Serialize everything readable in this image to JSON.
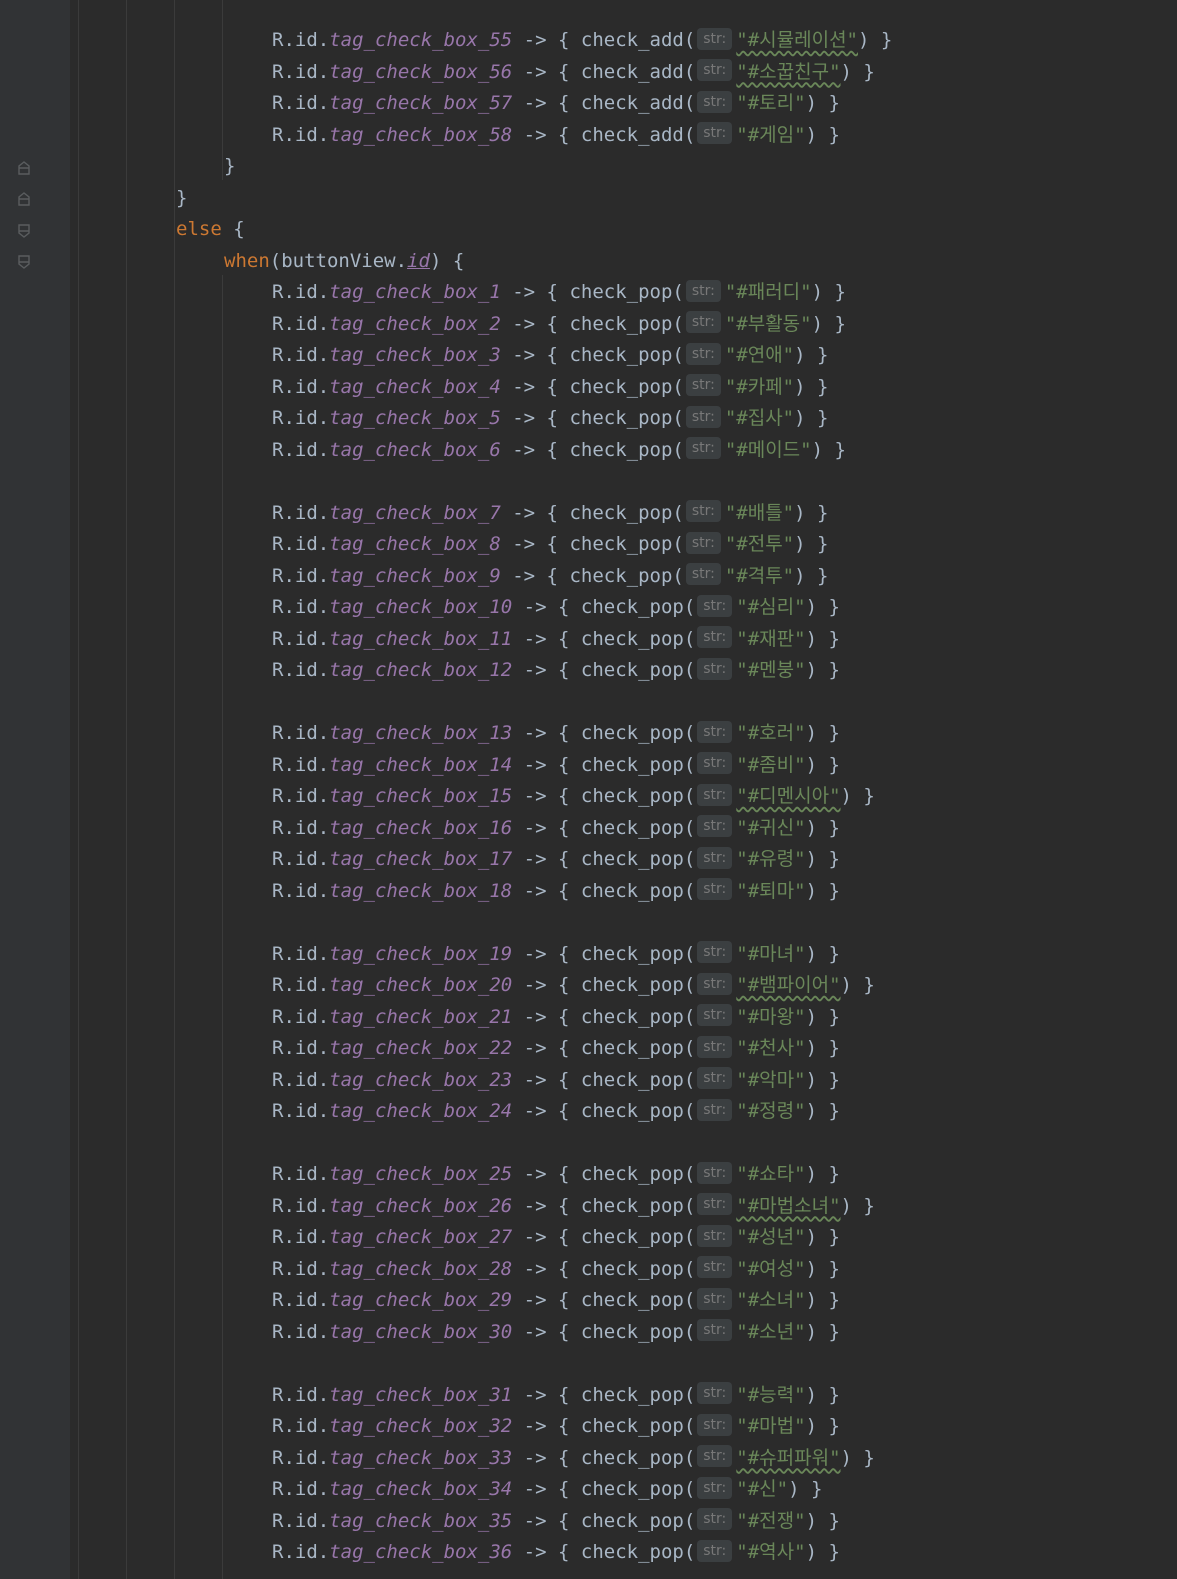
{
  "editor": {
    "lines_top": [
      {
        "prefix": "R.id.",
        "tag": "tag_check_box_55",
        "call": "check_add",
        "hint": "str:",
        "arg": "\"#시뮬레이션\""
      },
      {
        "prefix": "R.id.",
        "tag": "tag_check_box_56",
        "call": "check_add",
        "hint": "str:",
        "arg": "\"#소꿉친구\""
      },
      {
        "prefix": "R.id.",
        "tag": "tag_check_box_57",
        "call": "check_add",
        "hint": "str:",
        "arg": "\"#토리\""
      },
      {
        "prefix": "R.id.",
        "tag": "tag_check_box_58",
        "call": "check_add",
        "hint": "str:",
        "arg": "\"#게임\""
      }
    ],
    "close_brace": "}",
    "else_kw": "else",
    "open_brace": " {",
    "when_kw": "when",
    "when_expr_pre": "(buttonView.",
    "when_expr_id": "id",
    "when_expr_post": ") {",
    "arrow": " -> { ",
    "paren_open": "(",
    "paren_close": ") }",
    "lines_pop": [
      {
        "tag": "tag_check_box_1",
        "arg": "\"#패러디\""
      },
      {
        "tag": "tag_check_box_2",
        "arg": "\"#부활동\""
      },
      {
        "tag": "tag_check_box_3",
        "arg": "\"#연애\""
      },
      {
        "tag": "tag_check_box_4",
        "arg": "\"#카페\""
      },
      {
        "tag": "tag_check_box_5",
        "arg": "\"#집사\""
      },
      {
        "tag": "tag_check_box_6",
        "arg": "\"#메이드\""
      },
      {
        "tag": "tag_check_box_7",
        "arg": "\"#배틀\""
      },
      {
        "tag": "tag_check_box_8",
        "arg": "\"#전투\""
      },
      {
        "tag": "tag_check_box_9",
        "arg": "\"#격투\""
      },
      {
        "tag": "tag_check_box_10",
        "arg": "\"#심리\""
      },
      {
        "tag": "tag_check_box_11",
        "arg": "\"#재판\""
      },
      {
        "tag": "tag_check_box_12",
        "arg": "\"#멘붕\""
      },
      {
        "tag": "tag_check_box_13",
        "arg": "\"#호러\""
      },
      {
        "tag": "tag_check_box_14",
        "arg": "\"#좀비\""
      },
      {
        "tag": "tag_check_box_15",
        "arg": "\"#디멘시아\""
      },
      {
        "tag": "tag_check_box_16",
        "arg": "\"#귀신\""
      },
      {
        "tag": "tag_check_box_17",
        "arg": "\"#유령\""
      },
      {
        "tag": "tag_check_box_18",
        "arg": "\"#퇴마\""
      },
      {
        "tag": "tag_check_box_19",
        "arg": "\"#마녀\""
      },
      {
        "tag": "tag_check_box_20",
        "arg": "\"#뱀파이어\""
      },
      {
        "tag": "tag_check_box_21",
        "arg": "\"#마왕\""
      },
      {
        "tag": "tag_check_box_22",
        "arg": "\"#천사\""
      },
      {
        "tag": "tag_check_box_23",
        "arg": "\"#악마\""
      },
      {
        "tag": "tag_check_box_24",
        "arg": "\"#정령\""
      },
      {
        "tag": "tag_check_box_25",
        "arg": "\"#쇼타\""
      },
      {
        "tag": "tag_check_box_26",
        "arg": "\"#마법소녀\""
      },
      {
        "tag": "tag_check_box_27",
        "arg": "\"#성년\""
      },
      {
        "tag": "tag_check_box_28",
        "arg": "\"#여성\""
      },
      {
        "tag": "tag_check_box_29",
        "arg": "\"#소녀\""
      },
      {
        "tag": "tag_check_box_30",
        "arg": "\"#소년\""
      },
      {
        "tag": "tag_check_box_31",
        "arg": "\"#능력\""
      },
      {
        "tag": "tag_check_box_32",
        "arg": "\"#마법\""
      },
      {
        "tag": "tag_check_box_33",
        "arg": "\"#슈퍼파워\""
      },
      {
        "tag": "tag_check_box_34",
        "arg": "\"#신\""
      },
      {
        "tag": "tag_check_box_35",
        "arg": "\"#전쟁\""
      },
      {
        "tag": "tag_check_box_36",
        "arg": "\"#역사\""
      }
    ],
    "pop_call": "check_pop",
    "pop_hint": "str:",
    "pop_prefix": "R.id."
  }
}
